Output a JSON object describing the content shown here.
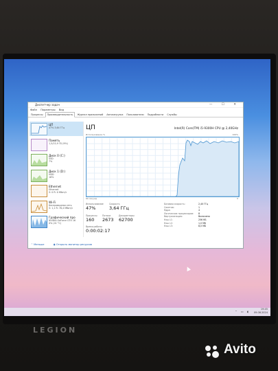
{
  "taskmgr": {
    "title": "Диспетчер задач",
    "controls": "— ☐ ✕",
    "menu": [
      "Файл",
      "Параметры",
      "Вид"
    ],
    "tabs": [
      "Процессы",
      "Производительность",
      "Журнал приложений",
      "Автозагрузка",
      "Пользователи",
      "Подробности",
      "Службы"
    ],
    "sidebar": [
      {
        "name": "ЦП",
        "sub": "47% 3,64 ГГц"
      },
      {
        "name": "Память",
        "sub": "1,5/15,9 ГБ (9%)"
      },
      {
        "name": "Диск 0 (C:)",
        "sub": "SSD\n7%"
      },
      {
        "name": "Диск 1 (D:)",
        "sub": "HDD\n16%"
      },
      {
        "name": "Ethernet",
        "sub": "Ethernet\nS: 0 R: 0 Кбит/с"
      },
      {
        "name": "Wi-Fi",
        "sub": "Беспроводная сеть\nS: 1,1 R: 76,4 Мбит/с"
      },
      {
        "name": "Графический про",
        "sub": "NVIDIA GeForce GTX 16\n0% (41 °C)"
      }
    ],
    "main": {
      "title": "ЦП",
      "cpu_name": "Intel(R) Core(TM) i5-9300H CPU @ 2,40GHz",
      "axis_left": "Использование %",
      "axis_right": "100%",
      "foot_left": "60 секунд",
      "foot_right": "0",
      "stats": {
        "util_label": "Использование",
        "util_value": "47%",
        "speed_label": "Скорость",
        "speed_value": "3,64 ГГц",
        "proc_label": "Процессы",
        "proc_value": "160",
        "threads_label": "Потоки",
        "threads_value": "2673",
        "handles_label": "Дескрипторы",
        "handles_value": "62700",
        "uptime_label": "Время работы",
        "uptime_value": "0:00:02:17"
      },
      "details": [
        {
          "k": "Базовая скорость:",
          "v": "2,40 ГГц"
        },
        {
          "k": "Сокетов:",
          "v": "1"
        },
        {
          "k": "Ядра:",
          "v": "4"
        },
        {
          "k": "Логических процессоров:",
          "v": "8"
        },
        {
          "k": "Виртуализация:",
          "v": "Включено"
        },
        {
          "k": "Кэш L1:",
          "v": "256 КБ"
        },
        {
          "k": "Кэш L2:",
          "v": "1,0 МБ"
        },
        {
          "k": "Кэш L3:",
          "v": "8,0 МБ"
        }
      ]
    },
    "footer": {
      "less": "Меньше",
      "monitor": "Открыть монитор ресурсов"
    }
  },
  "taskbar": {
    "time": "19:45",
    "date": "09.08.2024"
  },
  "laptop_brand": "LEGION",
  "watermark": "Avito"
}
